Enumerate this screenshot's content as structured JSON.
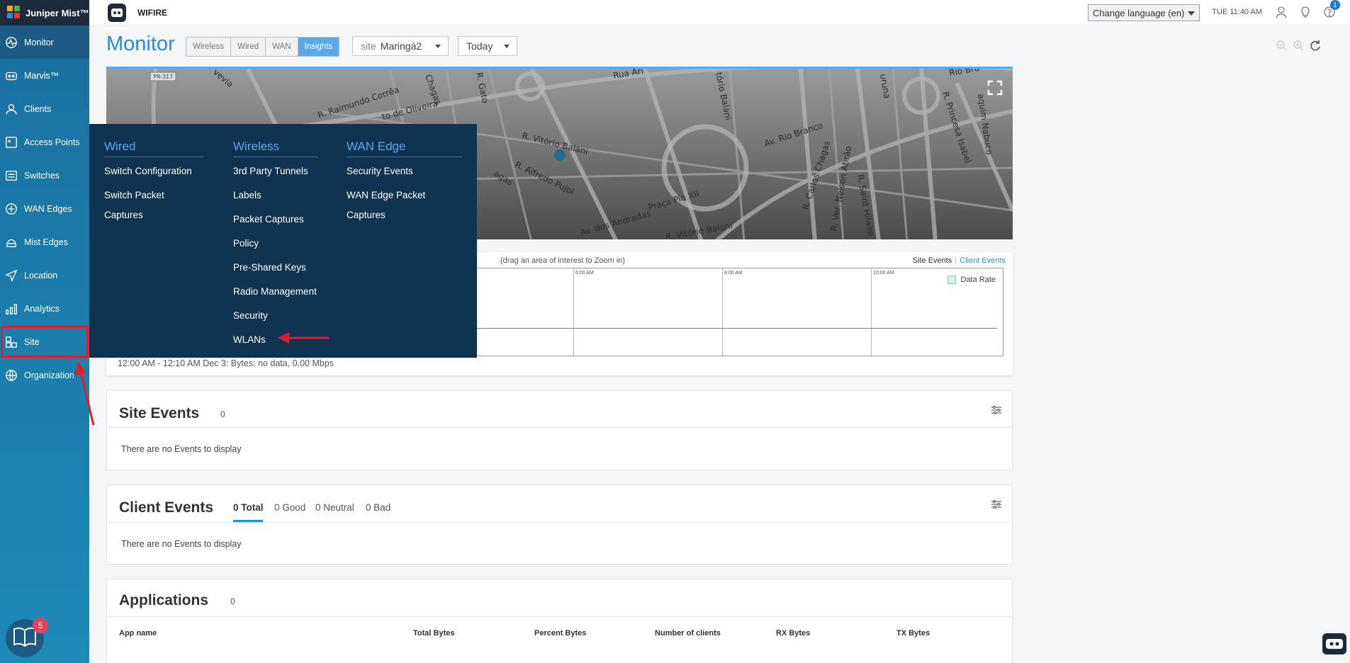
{
  "brand": {
    "name": "Juniper Mist™"
  },
  "sidebar": {
    "items": [
      {
        "label": "Monitor",
        "icon": "monitor-icon"
      },
      {
        "label": "Marvis™",
        "icon": "marvis-icon"
      },
      {
        "label": "Clients",
        "icon": "clients-icon"
      },
      {
        "label": "Access Points",
        "icon": "access-point-icon"
      },
      {
        "label": "Switches",
        "icon": "switches-icon"
      },
      {
        "label": "WAN Edges",
        "icon": "wan-edges-icon"
      },
      {
        "label": "Mist Edges",
        "icon": "mist-edges-icon"
      },
      {
        "label": "Location",
        "icon": "location-icon"
      },
      {
        "label": "Analytics",
        "icon": "analytics-icon"
      },
      {
        "label": "Site",
        "icon": "site-icon"
      },
      {
        "label": "Organization",
        "icon": "organization-icon"
      }
    ],
    "help_badge": "5"
  },
  "header": {
    "org_name": "WIFIRE",
    "language": "Change language (en)",
    "clock": "TUE 11:40 AM",
    "notification_count": "1"
  },
  "monitor": {
    "title": "Monitor",
    "tabs": [
      "Wireless",
      "Wired",
      "WAN",
      "Insights"
    ],
    "active_tab": "Insights",
    "site_label": "site",
    "site_value": "Maringá2",
    "date_value": "Today"
  },
  "map": {
    "streets": [
      "R. Raimundo Corrêa",
      "to de Oliveira",
      "Chagas",
      "R. Gato",
      "Rua Ari",
      "tório Balani",
      "R. Vitório Balani",
      "R. Alfredo Pujol",
      "Av. Rio Branco",
      "R. Carlos Chagas",
      "R. Ver. Nelson Abrão",
      "R. Saint Hilaire",
      "R. Princesa Isabel",
      "aquim Nabuco",
      "Praça Pio XII",
      "Av. dos Andradas",
      "R. Vitório Balani",
      "PR-317",
      "vevia",
      "agas",
      "uruna",
      "Rio Bra"
    ]
  },
  "timeline": {
    "hint": "(drag an area of interest to Zoom in)",
    "site_events_label": "Site Events",
    "client_events_label": "Client Events",
    "ticks": [
      "6:00 AM",
      "8:00 AM",
      "10:00 AM"
    ],
    "legend": "Data Rate",
    "summary": "12:00 AM - 12:10 AM Dec 3: Bytes: no data, 0.00 Mbps"
  },
  "site_events": {
    "title": "Site Events",
    "count": "0",
    "empty": "There are no Events to display"
  },
  "client_events": {
    "title": "Client Events",
    "tabs": [
      "0 Total",
      "0 Good",
      "0 Neutral",
      "0 Bad"
    ],
    "empty": "There are no Events to display"
  },
  "applications": {
    "title": "Applications",
    "count": "0",
    "columns": [
      "App name",
      "Total Bytes",
      "Percent Bytes",
      "Number of clients",
      "RX Bytes",
      "TX Bytes"
    ]
  },
  "site_menu": {
    "wired": {
      "heading": "Wired",
      "items": [
        "Switch Configuration",
        "Switch Packet Captures"
      ]
    },
    "wireless": {
      "heading": "Wireless",
      "items": [
        "3rd Party Tunnels",
        "Labels",
        "Packet Captures",
        "Policy",
        "Pre-Shared Keys",
        "Radio Management",
        "Security",
        "WLANs"
      ]
    },
    "wan_edge": {
      "heading": "WAN Edge",
      "items": [
        "Security Events",
        "WAN Edge Packet Captures"
      ]
    }
  },
  "colors": {
    "accent": "#2b8ad8",
    "sidebar": "#1a7db0",
    "menu_bg": "#0f3350",
    "highlight_red": "#e11d2a"
  }
}
